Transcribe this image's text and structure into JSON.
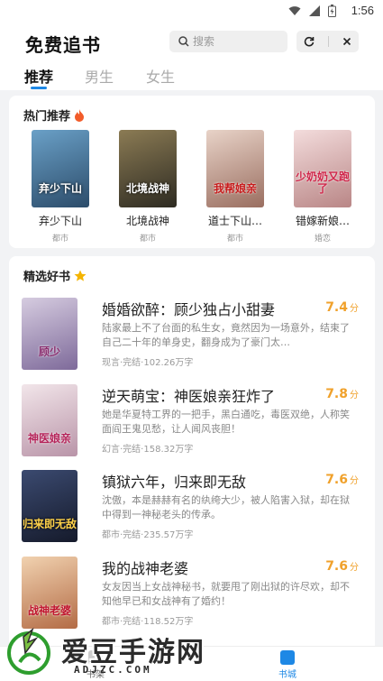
{
  "status_bar": {
    "time": "1:56"
  },
  "header": {
    "app_title": "免费追书",
    "search_placeholder": "搜索",
    "tabs": [
      {
        "label": "推荐",
        "active": true
      },
      {
        "label": "男生",
        "active": false
      },
      {
        "label": "女生",
        "active": false
      }
    ]
  },
  "hot": {
    "title": "热门推荐",
    "icon": "fire-icon",
    "items": [
      {
        "name": "弃少下山",
        "category": "都市",
        "cover_text": "弃少下山",
        "cover_color": "#3a6f96"
      },
      {
        "name": "北境战神",
        "category": "都市",
        "cover_text": "北境战神",
        "cover_color": "#4a4a3a"
      },
      {
        "name": "道士下山…",
        "category": "都市",
        "cover_text": "我帮娘亲",
        "cover_color": "#c9a89a"
      },
      {
        "name": "错嫁新娘…",
        "category": "婚恋",
        "cover_text": "少奶奶又跑了",
        "cover_color": "#d9b3b3"
      }
    ]
  },
  "featured": {
    "title": "精选好书",
    "icon": "star-icon",
    "books": [
      {
        "title": "婚婚欲醉：顾少独占小甜妻",
        "score": "7.4",
        "unit": "分",
        "desc": "陆家最上不了台面的私生女，竟然因为一场意外，结束了自己二十年的单身史，翻身成为了豪门太…",
        "meta": "现言·完结·102.26万字",
        "cover_text": "顾少",
        "cover_color": "#b9a6c9"
      },
      {
        "title": "逆天萌宝：神医娘亲狂炸了",
        "score": "7.8",
        "unit": "分",
        "desc": "她是华夏特工界的一把手，黑白通吃，毒医双绝，人称笑面阎王鬼见愁，让人闻风丧胆！",
        "meta": "幻言·完结·158.32万字",
        "cover_text": "神医娘亲",
        "cover_color": "#e7d6dd"
      },
      {
        "title": "镇狱六年，归来即无敌",
        "score": "7.6",
        "unit": "分",
        "desc": "沈傲，本是赫赫有名的纨绔大少，被人陷害入狱，却在狱中得到一神秘老头的传承。",
        "meta": "都市·完结·235.57万字",
        "cover_text": "归来即无敌",
        "cover_color": "#2e3550"
      },
      {
        "title": "我的战神老婆",
        "score": "7.6",
        "unit": "分",
        "desc": "女友因当上女战神秘书，就要甩了刚出狱的许尽欢，却不知他早已和女战神有了婚约！",
        "meta": "都市·完结·118.52万字",
        "cover_text": "战神老婆",
        "cover_color": "#d8a27a"
      }
    ]
  },
  "bottom_nav": [
    {
      "label": "书架",
      "active": false
    },
    {
      "label": "书城",
      "active": true
    }
  ],
  "watermark": {
    "text": "爱豆手游网",
    "sub": "ADJZC.COM"
  }
}
